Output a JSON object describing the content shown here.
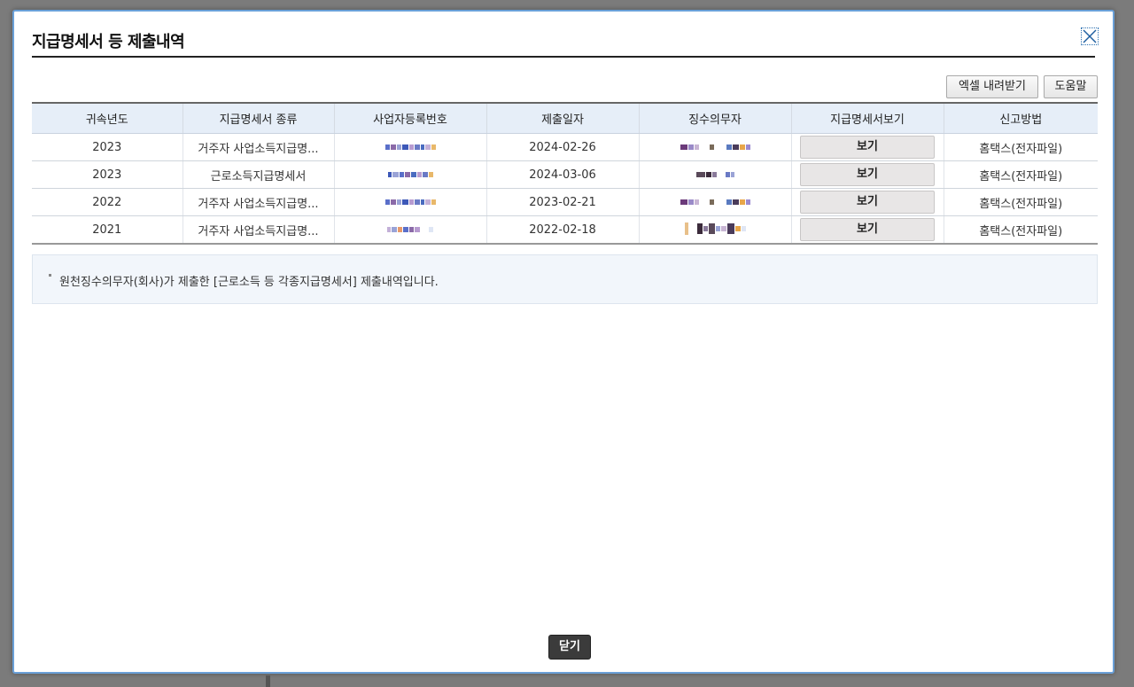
{
  "dialog": {
    "title": "지급명세서 등 제출내역",
    "excel_label": "엑셀 내려받기",
    "help_label": "도움말",
    "close_label": "닫기"
  },
  "table": {
    "headers": [
      "귀속년도",
      "지급명세서 종류",
      "사업자등록번호",
      "제출일자",
      "징수의무자",
      "지급명세서보기",
      "신고방법"
    ],
    "rows": [
      {
        "year": "2023",
        "type": "거주자 사업소득지급명...",
        "date": "2024-02-26",
        "view": "보기",
        "method": "홈택스(전자파일)"
      },
      {
        "year": "2023",
        "type": "근로소득지급명세서",
        "date": "2024-03-06",
        "view": "보기",
        "method": "홈택스(전자파일)"
      },
      {
        "year": "2022",
        "type": "거주자 사업소득지급명...",
        "date": "2023-02-21",
        "view": "보기",
        "method": "홈택스(전자파일)"
      },
      {
        "year": "2021",
        "type": "거주자 사업소득지급명...",
        "date": "2022-02-18",
        "view": "보기",
        "method": "홈택스(전자파일)"
      }
    ]
  },
  "note": {
    "text": "원천징수의무자(회사)가 제출한 [근로소득 등 각종지급명세서] 제출내역입니다."
  },
  "colors": {
    "header_bg": "#e6eef8",
    "modal_border": "#6aa0d8",
    "overlay": "#7b7b7b"
  }
}
